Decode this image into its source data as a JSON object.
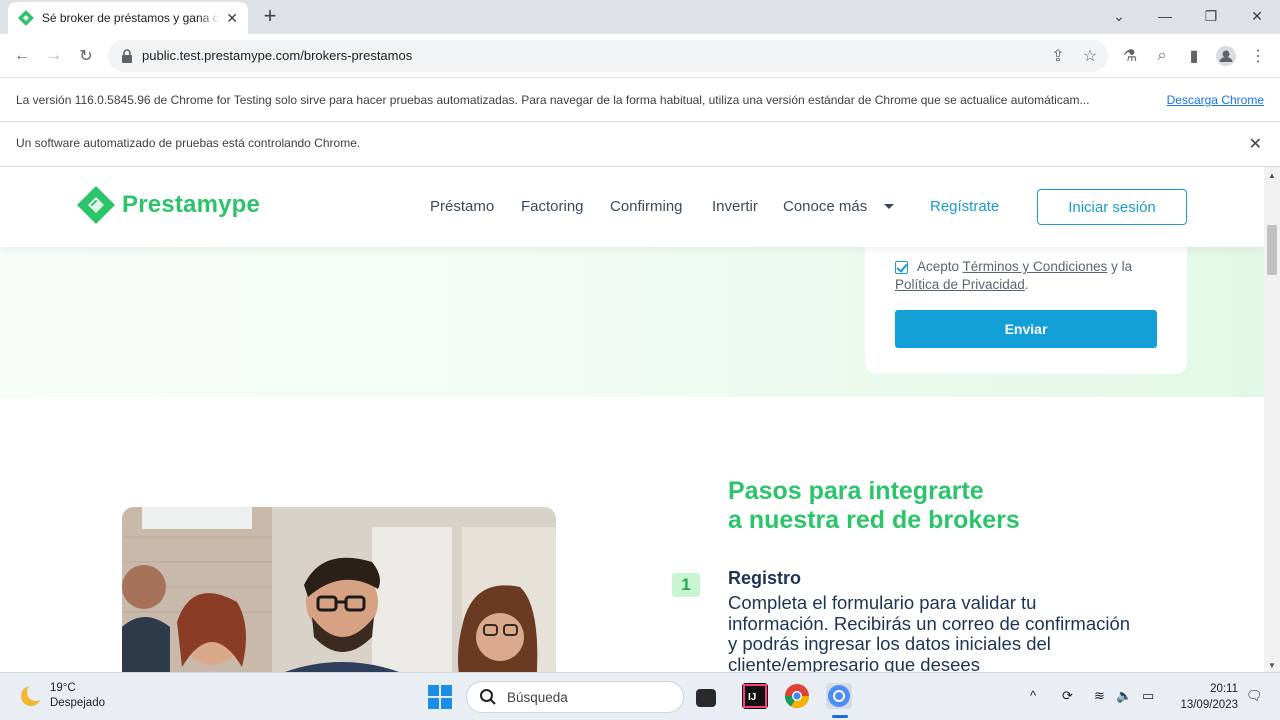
{
  "browser": {
    "tab_title": "Sé broker de préstamos y gana c",
    "url": "public.test.prestamype.com/brokers-prestamos",
    "infobar_version": "La versión 116.0.5845.96 de Chrome for Testing solo sirve para hacer pruebas automatizadas. Para navegar de la forma habitual, utiliza una versión estándar de Chrome que se actualice automáticam...",
    "infobar_link": "Descarga Chrome",
    "infobar_automation": "Un software automatizado de pruebas está controlando Chrome."
  },
  "site": {
    "brand": "Prestamype",
    "brand_color": "#2cc46b",
    "accent_color": "#129fd6",
    "nav": [
      "Préstamo",
      "Factoring",
      "Confirming",
      "Invertir",
      "Conoce más"
    ],
    "register": "Regístrate",
    "login": "Iniciar sesión"
  },
  "form": {
    "accept": "Acepto",
    "terms_link": "Términos y Condiciones",
    "and": "y la",
    "privacy_link": "Política de Privacidad",
    "period": ".",
    "submit": "Enviar",
    "checked": true
  },
  "steps": {
    "title_line1": "Pasos para integrarte",
    "title_line2": "a nuestra red de brokers",
    "items": [
      {
        "number": "1",
        "title": "Registro",
        "description": "Completa el formulario para validar tu información. Recibirás un correo de confirmación y podrás ingresar los datos iniciales del cliente/empresario que desees"
      }
    ]
  },
  "taskbar": {
    "temperature": "19°C",
    "weather": "Despejado",
    "search": "Búsqueda",
    "time": "20:11",
    "date": "13/09/2023"
  }
}
